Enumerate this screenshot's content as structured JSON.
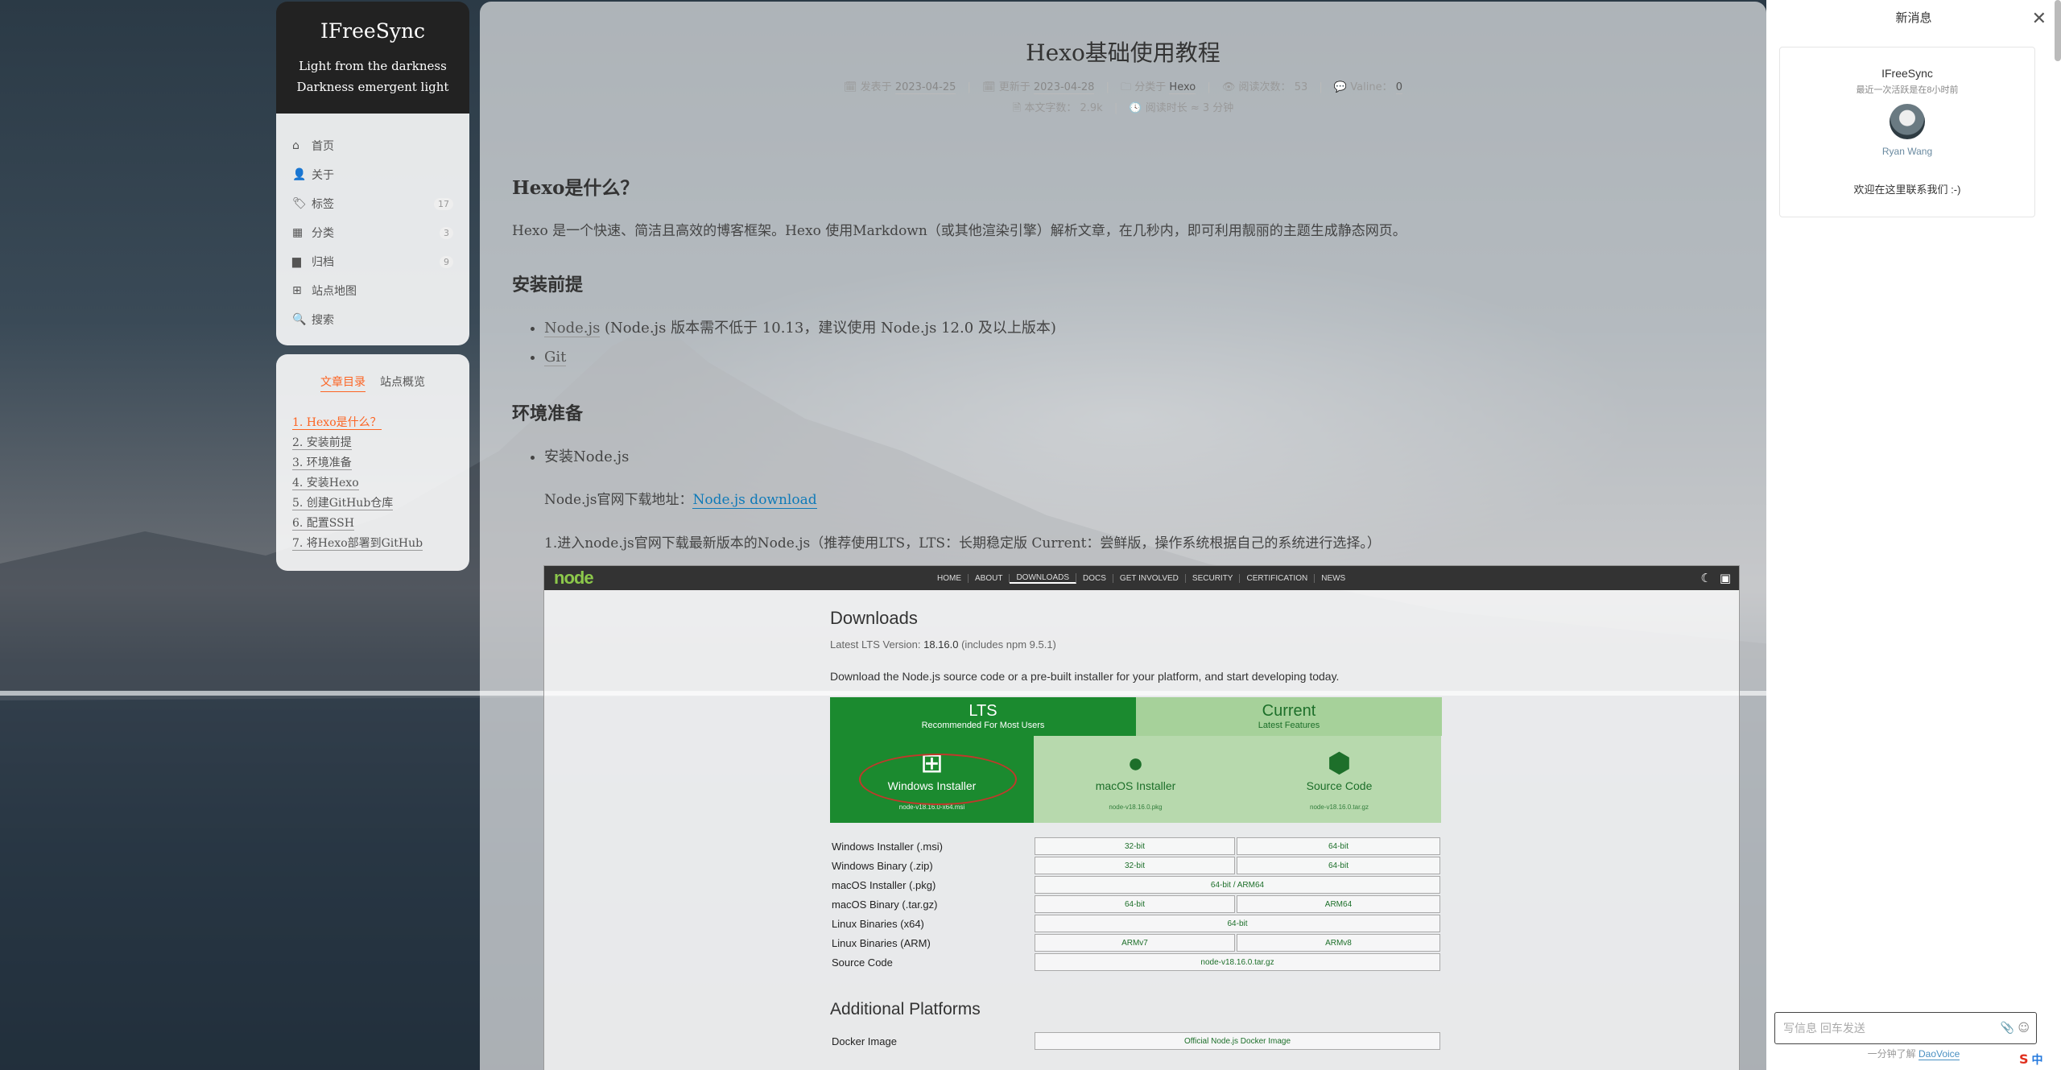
{
  "brand": {
    "title": "IFreeSync",
    "subtitle_1": "Light from the darkness",
    "subtitle_2": "Darkness emergent light"
  },
  "menu": [
    {
      "icon": "home-icon",
      "glyph": "⌂",
      "label": "首页",
      "badge": ""
    },
    {
      "icon": "user-icon",
      "glyph": "👤",
      "label": "关于",
      "badge": ""
    },
    {
      "icon": "tags-icon",
      "glyph": "🏷",
      "label": "标签",
      "badge": "17"
    },
    {
      "icon": "grid-icon",
      "glyph": "▦",
      "label": "分类",
      "badge": "3"
    },
    {
      "icon": "archive-icon",
      "glyph": "▆",
      "label": "归档",
      "badge": "9"
    },
    {
      "icon": "sitemap-icon",
      "glyph": "⊞",
      "label": "站点地图",
      "badge": ""
    },
    {
      "icon": "search-icon",
      "glyph": "🔍",
      "label": "搜索",
      "badge": ""
    }
  ],
  "toc": {
    "tab_active": "文章目录",
    "tab_other": "站点概览",
    "items": [
      "1. Hexo是什么？",
      "2. 安装前提",
      "3. 环境准备",
      "4. 安装Hexo",
      "5. 创建GitHub仓库",
      "6. 配置SSH",
      "7. 将Hexo部署到GitHub"
    ]
  },
  "post": {
    "title": "Hexo基础使用教程",
    "meta": {
      "published_label": "发表于",
      "published": "2023-04-25",
      "updated_label": "更新于",
      "updated": "2023-04-28",
      "category_label": "分类于",
      "category": "Hexo",
      "views_label": "阅读次数：",
      "views": "53",
      "valine_label": "Valine：",
      "valine": "0",
      "words_label": "本文字数：",
      "words": "2.9k",
      "readtime_label": "阅读时长 ≈",
      "readtime": "3 分钟"
    },
    "h_what": "Hexo是什么？",
    "p_intro": "Hexo 是一个快速、简洁且高效的博客框架。Hexo 使用Markdown（或其他渲染引擎）解析文章，在几秒内，即可利用靓丽的主题生成静态网页。",
    "h_prereq": "安装前提",
    "li_node_link": "Node.js",
    "li_node_text": " (Node.js 版本需不低于 10.13，建议使用 Node.js 12.0 及以上版本)",
    "li_git": "Git",
    "h_env": "环境准备",
    "li_install_node": "安装Node.js",
    "p_download_label": "Node.js官网下载地址：",
    "p_download_link": "Node.js download",
    "p_step1": "1.进入node.js官网下载最新版本的Node.js（推荐使用LTS，LTS：长期稳定版 Current：尝鲜版，操作系统根据自己的系统进行选择。）"
  },
  "nodejs_shot": {
    "logo_main": "node",
    "nav": [
      "HOME",
      "ABOUT",
      "DOWNLOADS",
      "DOCS",
      "GET INVOLVED",
      "SECURITY",
      "CERTIFICATION",
      "NEWS"
    ],
    "heading": "Downloads",
    "lts_prefix": "Latest LTS Version: ",
    "lts_version": "18.16.0",
    "lts_suffix": " (includes npm 9.5.1)",
    "desc": "Download the Node.js source code or a pre-built installer for your platform, and start developing today.",
    "tab_lts": "LTS",
    "tab_lts_sub": "Recommended For Most Users",
    "tab_current": "Current",
    "tab_current_sub": "Latest Features",
    "dl_win": "Windows Installer",
    "dl_win_file": "node-v18.16.0-x64.msi",
    "dl_mac": "macOS Installer",
    "dl_mac_file": "node-v18.16.0.pkg",
    "dl_src": "Source Code",
    "dl_src_file": "node-v18.16.0.tar.gz",
    "rows": [
      {
        "label": "Windows Installer (.msi)",
        "a": "32-bit",
        "b": "64-bit"
      },
      {
        "label": "Windows Binary (.zip)",
        "a": "32-bit",
        "b": "64-bit"
      },
      {
        "label": "macOS Installer (.pkg)",
        "span": "64-bit / ARM64"
      },
      {
        "label": "macOS Binary (.tar.gz)",
        "a": "64-bit",
        "b": "ARM64"
      },
      {
        "label": "Linux Binaries (x64)",
        "span": "64-bit"
      },
      {
        "label": "Linux Binaries (ARM)",
        "a": "ARMv7",
        "b": "ARMv8"
      },
      {
        "label": "Source Code",
        "span": "node-v18.16.0.tar.gz"
      }
    ],
    "heading2": "Additional Platforms",
    "docker_label": "Docker Image",
    "docker_link": "Official Node.js Docker Image"
  },
  "chat": {
    "header": "新消息",
    "org": "IFreeSync",
    "status": "最近一次活跃是在8小时前",
    "agent": "Ryan Wang",
    "welcome": "欢迎在这里联系我们 :-)",
    "input_placeholder": "写信息 回车发送",
    "footer_text": "一分钟了解 ",
    "footer_link": "DaoVoice"
  },
  "colors": {
    "accent": "#fc6423",
    "node_green": "#1b8a2f",
    "link_blue": "#0f7ab8"
  }
}
